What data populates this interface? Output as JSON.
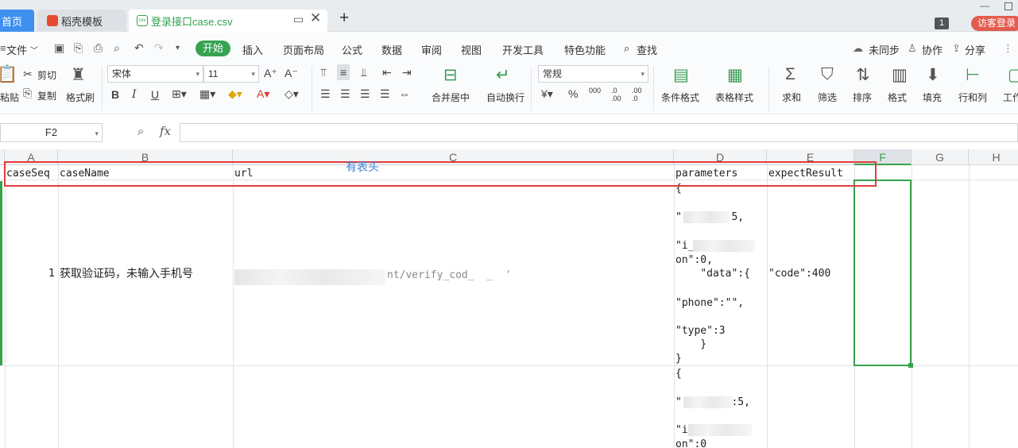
{
  "tabs": {
    "home": "首页",
    "template": "稻壳模板",
    "file": "登录接口case.csv",
    "file_icon": "csv"
  },
  "window": {
    "count": "1",
    "guest": "访客登录"
  },
  "menu": {
    "file": "文件",
    "start": "开始",
    "insert": "插入",
    "layout": "页面布局",
    "formula": "公式",
    "data": "数据",
    "review": "审阅",
    "view": "视图",
    "dev": "开发工具",
    "special": "特色功能",
    "search": "查找",
    "unsynced": "未同步",
    "collab": "协作",
    "share": "分享"
  },
  "ribbon": {
    "paste": "粘贴",
    "cut": "剪切",
    "copy": "复制",
    "painter": "格式刷",
    "font": "宋体",
    "size": "11",
    "merge": "合并居中",
    "wrap": "自动换行",
    "numfmt": "常规",
    "cond": "条件格式",
    "tblstyle": "表格样式",
    "sum": "求和",
    "filter": "筛选",
    "sort": "排序",
    "fmt": "格式",
    "fill": "填充",
    "rowcol": "行和列",
    "ws": "工作"
  },
  "formula_bar": {
    "cell": "F2",
    "fx": "fx",
    "value": ""
  },
  "columns": [
    "A",
    "B",
    "C",
    "D",
    "E",
    "F",
    "G",
    "H"
  ],
  "headers": {
    "a": "caseSeq",
    "b": "caseName",
    "c": "url",
    "d": "parameters",
    "e": "expectResult"
  },
  "annotation": "有表头",
  "row1": {
    "a": "1",
    "b": "获取验证码，未输入手机号",
    "c": "nt/verify_cod_  _  '",
    "d": [
      "{",
      "\"      \":5,",
      "\"i_        :",
      "on\":0,",
      "    \"data\":{",
      "\"phone\":\"\",",
      "\"type\":3",
      "    }",
      "}"
    ],
    "e": "\"code\":400"
  },
  "row2": {
    "d": [
      "{",
      "\"       \":5,",
      "\"i_      :",
      "on\":0"
    ]
  }
}
